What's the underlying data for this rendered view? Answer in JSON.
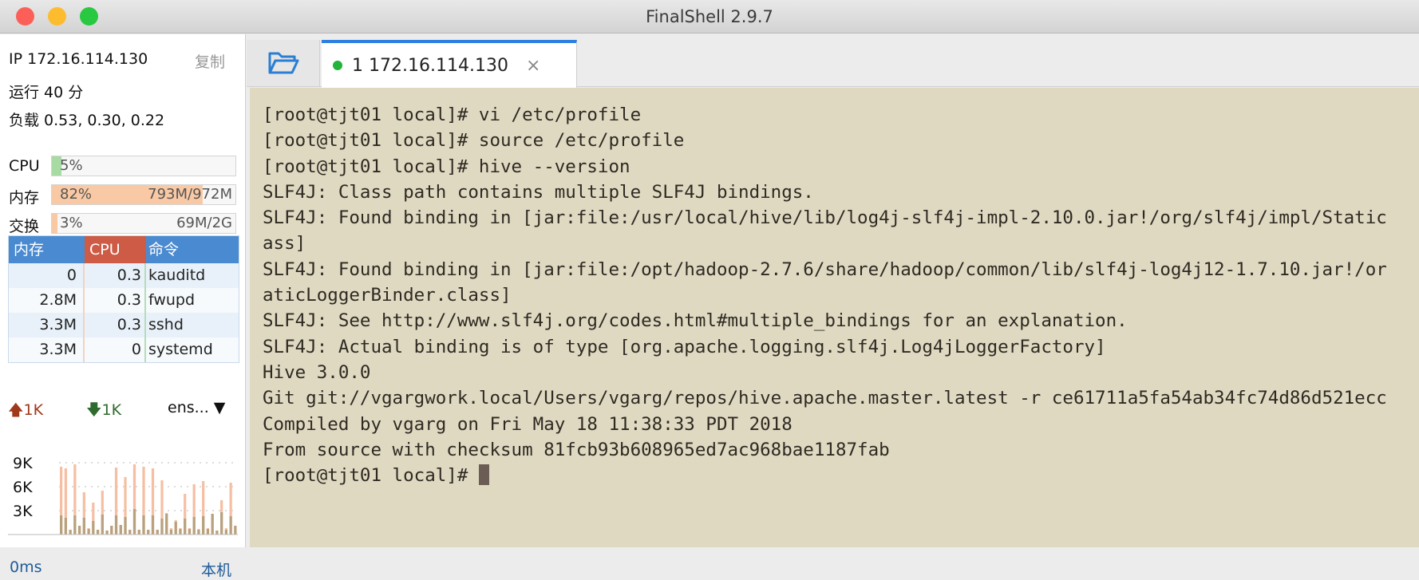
{
  "window": {
    "title": "FinalShell 2.9.7"
  },
  "sidebar": {
    "ip": "IP 172.16.114.130",
    "copy_label": "复制",
    "uptime": "运行 40 分",
    "load": "负载 0.53, 0.30, 0.22",
    "meters": [
      {
        "label": "CPU",
        "percent_text": "5%",
        "amount": "",
        "fill": 5,
        "color": "#a8dba4"
      },
      {
        "label": "内存",
        "percent_text": "82%",
        "amount": "793M/972M",
        "fill": 82,
        "color": "#f8c9a4"
      },
      {
        "label": "交换",
        "percent_text": "3%",
        "amount": "69M/2G",
        "fill": 3,
        "color": "#f8c9a4"
      }
    ],
    "process_table": {
      "headers": [
        "内存",
        "CPU",
        "命令"
      ],
      "rows": [
        [
          "0",
          "0.3",
          "kauditd"
        ],
        [
          "2.8M",
          "0.3",
          "fwupd"
        ],
        [
          "3.3M",
          "0.3",
          "sshd"
        ],
        [
          "3.3M",
          "0",
          "systemd"
        ]
      ]
    },
    "network": {
      "upload": "1K",
      "download": "1K",
      "interface": "ens...",
      "upload_color": "#a0391a",
      "download_color": "#2e6b2e"
    },
    "chart_data": {
      "type": "bar",
      "yticks": [
        "9K",
        "6K",
        "3K"
      ],
      "ylim": [
        0,
        10
      ],
      "series": [
        {
          "values": [
            8.5,
            8.3,
            0.5,
            8.8,
            1,
            5.3,
            0.8,
            4,
            0.5,
            5.5,
            0.5,
            1,
            8.4,
            1.2,
            7.2,
            0.5,
            8.8,
            0.5,
            8.5,
            0.5,
            8.3,
            0.5,
            6.8,
            2.7,
            0.8,
            1.8,
            0.8,
            5.1,
            0.8,
            6.3,
            0.7,
            6.7,
            0.8,
            2.6,
            0.5,
            4.3,
            0.8,
            6.5,
            1.1
          ],
          "color": "#f6bfa3"
        },
        {
          "values": [
            2.4,
            2.1,
            0.6,
            2.4,
            1.1,
            2.1,
            0.7,
            1.7,
            0.6,
            2.5,
            0.5,
            1.1,
            2.4,
            1.2,
            2.2,
            0.6,
            3.2,
            0.6,
            2.4,
            0.6,
            2.4,
            0.6,
            2.0,
            2.6,
            0.6,
            1.6,
            0.7,
            2.0,
            0.7,
            2.2,
            0.6,
            2.3,
            0.7,
            2.6,
            0.5,
            2.8,
            0.6,
            2.3,
            1.1
          ],
          "color": "#b8a27e"
        }
      ]
    },
    "latency": "0ms",
    "host_label": "本机"
  },
  "tabs": [
    {
      "label": "1 172.16.114.130",
      "status_color": "#22b33a"
    }
  ],
  "terminal": {
    "lines": [
      "[root@tjt01 local]# vi /etc/profile",
      "[root@tjt01 local]# source /etc/profile",
      "[root@tjt01 local]# hive --version",
      "SLF4J: Class path contains multiple SLF4J bindings.",
      "SLF4J: Found binding in [jar:file:/usr/local/hive/lib/log4j-slf4j-impl-2.10.0.jar!/org/slf4j/impl/Static",
      "ass]",
      "SLF4J: Found binding in [jar:file:/opt/hadoop-2.7.6/share/hadoop/common/lib/slf4j-log4j12-1.7.10.jar!/or",
      "aticLoggerBinder.class]",
      "SLF4J: See http://www.slf4j.org/codes.html#multiple_bindings for an explanation.",
      "SLF4J: Actual binding is of type [org.apache.logging.slf4j.Log4jLoggerFactory]",
      "Hive 3.0.0",
      "Git git://vgargwork.local/Users/vgarg/repos/hive.apache.master.latest -r ce61711a5fa54ab34fc74d86d521ecc",
      "Compiled by vgarg on Fri May 18 11:38:33 PDT 2018",
      "From source with checksum 81fcb93b608965ed7ac968bae1187fab"
    ],
    "prompt": "[root@tjt01 local]# "
  }
}
